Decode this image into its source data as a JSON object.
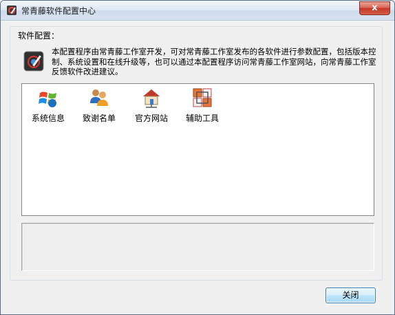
{
  "window": {
    "title": "常青藤软件配置中心",
    "close_glyph": "x"
  },
  "group": {
    "label": "软件配置："
  },
  "description": "本配置程序由常青藤工作室开发，可对常青藤工作室发布的各软件进行参数配置，包括版本控制、系统设置和在线升级等，也可以通过本配置程序访问常青藤工作室网站，向常青藤工作室反馈软件改进建议。",
  "items": [
    {
      "label": "系统信息",
      "icon": "windows-logo-icon"
    },
    {
      "label": "致谢名单",
      "icon": "users-icon"
    },
    {
      "label": "官方网站",
      "icon": "home-network-icon"
    },
    {
      "label": "辅助工具",
      "icon": "tools-grid-icon"
    }
  ],
  "buttons": {
    "close": "关闭"
  }
}
